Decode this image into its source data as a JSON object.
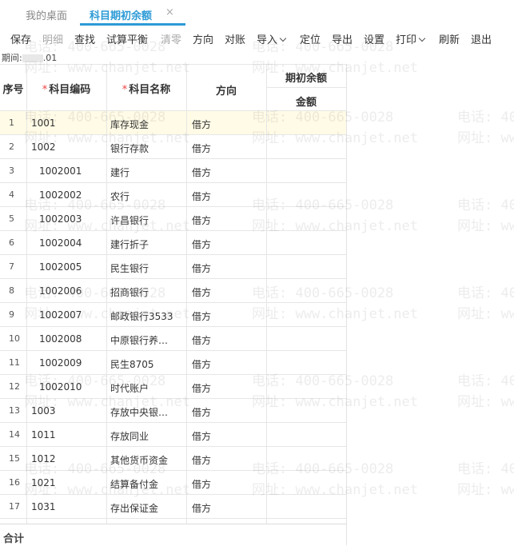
{
  "tabs": {
    "home": "我的桌面",
    "active": "科目期初余额",
    "close": "×"
  },
  "toolbar": [
    {
      "label": "保存",
      "disabled": false,
      "dropdown": false
    },
    {
      "label": "明细",
      "disabled": true,
      "dropdown": false
    },
    {
      "label": "查找",
      "disabled": false,
      "dropdown": false
    },
    {
      "label": "试算平衡",
      "disabled": false,
      "dropdown": false
    },
    {
      "label": "清零",
      "disabled": true,
      "dropdown": false
    },
    {
      "label": "方向",
      "disabled": false,
      "dropdown": false
    },
    {
      "label": "对账",
      "disabled": false,
      "dropdown": false
    },
    {
      "label": "导入",
      "disabled": false,
      "dropdown": true
    },
    {
      "label": "定位",
      "disabled": false,
      "dropdown": false
    },
    {
      "label": "导出",
      "disabled": false,
      "dropdown": false
    },
    {
      "label": "设置",
      "disabled": false,
      "dropdown": false
    },
    {
      "label": "打印",
      "disabled": false,
      "dropdown": true
    },
    {
      "label": "刷新",
      "disabled": false,
      "dropdown": false
    },
    {
      "label": "退出",
      "disabled": false,
      "dropdown": false
    }
  ],
  "period": {
    "label": "期间:",
    "value": ".01"
  },
  "table": {
    "headers": {
      "index": "序号",
      "code_mark": "*",
      "code": "科目编码",
      "name_mark": "*",
      "name": "科目名称",
      "direction": "方向",
      "opening": "期初余额",
      "amount": "金额"
    },
    "rows": [
      {
        "index": "1",
        "code": "1001",
        "name": "库存现金",
        "direction": "借方",
        "level": 1,
        "selected": true
      },
      {
        "index": "2",
        "code": "1002",
        "name": "银行存款",
        "direction": "借方",
        "level": 1
      },
      {
        "index": "3",
        "code": "1002001",
        "name": "建行",
        "direction": "借方",
        "level": 2
      },
      {
        "index": "4",
        "code": "1002002",
        "name": "农行",
        "direction": "借方",
        "level": 2
      },
      {
        "index": "5",
        "code": "1002003",
        "name": "许昌银行",
        "direction": "借方",
        "level": 2
      },
      {
        "index": "6",
        "code": "1002004",
        "name": "建行折子",
        "direction": "借方",
        "level": 2
      },
      {
        "index": "7",
        "code": "1002005",
        "name": "民生银行",
        "direction": "借方",
        "level": 2
      },
      {
        "index": "8",
        "code": "1002006",
        "name": "招商银行",
        "direction": "借方",
        "level": 2
      },
      {
        "index": "9",
        "code": "1002007",
        "name": "邮政银行3533",
        "direction": "借方",
        "level": 2
      },
      {
        "index": "10",
        "code": "1002008",
        "name": "中原银行养…",
        "direction": "借方",
        "level": 2
      },
      {
        "index": "11",
        "code": "1002009",
        "name": "民生8705",
        "direction": "借方",
        "level": 2
      },
      {
        "index": "12",
        "code": "1002010",
        "name": "时代账户",
        "direction": "借方",
        "level": 2
      },
      {
        "index": "13",
        "code": "1003",
        "name": "存放中央银…",
        "direction": "借方",
        "level": 1
      },
      {
        "index": "14",
        "code": "1011",
        "name": "存放同业",
        "direction": "借方",
        "level": 1
      },
      {
        "index": "15",
        "code": "1012",
        "name": "其他货币资金",
        "direction": "借方",
        "level": 1
      },
      {
        "index": "16",
        "code": "1021",
        "name": "结算备付金",
        "direction": "借方",
        "level": 1
      },
      {
        "index": "17",
        "code": "1031",
        "name": "存出保证金",
        "direction": "借方",
        "level": 1
      }
    ]
  },
  "total_label": "合计",
  "watermark": {
    "phone": "电话: 400-665-0028",
    "site": "网址: www.chanjet.net"
  },
  "colors": {
    "accent": "#2d9bd6",
    "selected_row": "#fffbe6",
    "required_mark": "#e44444"
  }
}
